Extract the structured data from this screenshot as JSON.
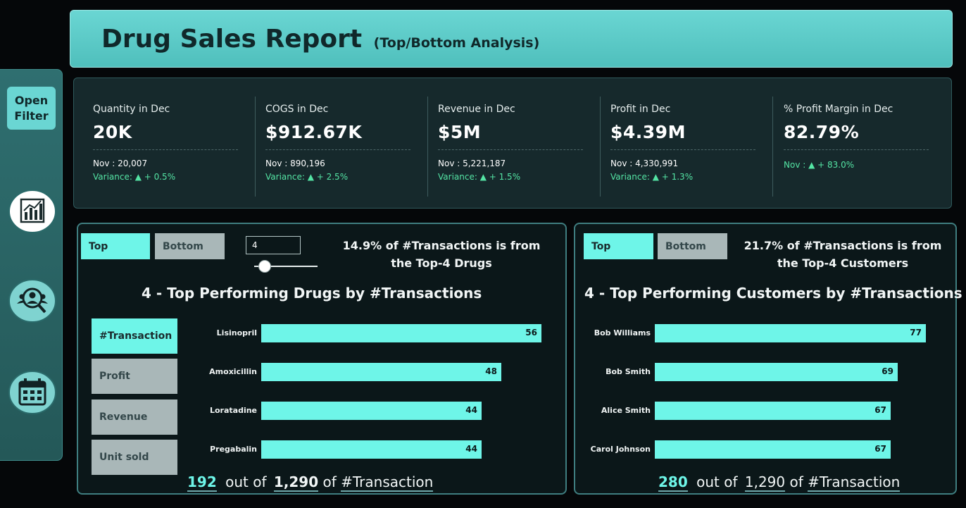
{
  "header": {
    "title": "Drug Sales Report",
    "subtitle": "(Top/Bottom Analysis)"
  },
  "sidebar": {
    "open_filter": "Open\nFilter",
    "icons": [
      "bar-chart-icon",
      "customers-search-icon",
      "calendar-icon"
    ]
  },
  "kpis": [
    {
      "label": "Quantity in Dec",
      "value": "20K",
      "prev": "Nov : 20,007",
      "variance": "Variance: ▲ + 0.5%"
    },
    {
      "label": "COGS in Dec",
      "value": "$912.67K",
      "prev": "Nov : 890,196",
      "variance": "Variance: ▲ + 2.5%"
    },
    {
      "label": "Revenue in Dec",
      "value": "$5M",
      "prev": "Nov : 5,221,187",
      "variance": "Variance: ▲ + 1.5%"
    },
    {
      "label": "Profit in Dec",
      "value": "$4.39M",
      "prev": "Nov : 4,330,991",
      "variance": "Variance: ▲ + 1.3%"
    },
    {
      "label": "% Profit Margin in Dec",
      "value": "82.79%",
      "prev": "",
      "variance": "Nov : ▲ + 83.0%"
    }
  ],
  "drugs_panel": {
    "top_label": "Top",
    "bottom_label": "Bottom",
    "n_value": "4",
    "insight": "14.9% of #Transactions is from the Top-4 Drugs",
    "title": "4 - Top Performing Drugs by #Transactions",
    "metrics": [
      "#Transaction",
      "Profit",
      "Revenue",
      "Unit sold"
    ],
    "active_metric": "#Transaction",
    "footer": {
      "count": "192",
      "mid": "out of",
      "total": "1,290",
      "of": "of",
      "measure": "#Transaction"
    }
  },
  "customers_panel": {
    "top_label": "Top",
    "bottom_label": "Bottom",
    "insight": "21.7% of #Transactions is from the Top-4 Customers",
    "title": "4 - Top Performing Customers by #Transactions",
    "footer": {
      "count": "280",
      "mid": "out of",
      "total": "1,290",
      "of": "of",
      "measure": "#Transaction"
    }
  },
  "chart_data": [
    {
      "type": "bar",
      "orientation": "horizontal",
      "categories": [
        "Lisinopril",
        "Amoxicillin",
        "Loratadine",
        "Pregabalin"
      ],
      "values": [
        56,
        48,
        44,
        44
      ]
    },
    {
      "type": "bar",
      "orientation": "horizontal",
      "categories": [
        "Bob Williams",
        "Bob Smith",
        "Alice Smith",
        "Carol Johnson"
      ],
      "values": [
        77,
        69,
        67,
        67
      ]
    }
  ],
  "colors": {
    "accent": "#6ef5e8",
    "header": "#5cc9c6",
    "positive": "#54e4a4",
    "panel": "#16292c"
  }
}
